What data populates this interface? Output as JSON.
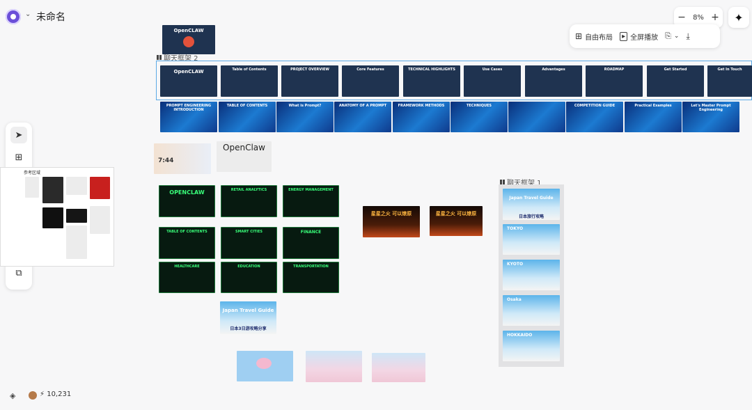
{
  "header": {
    "title": "未命名"
  },
  "zoom": {
    "minus": "−",
    "level": "8%",
    "plus": "+"
  },
  "toolbar": {
    "free_layout": "自由布局",
    "fullscreen": "全屏播放"
  },
  "frames": {
    "frame2": "聊天框架 2",
    "frame1": "聊天框架 1"
  },
  "ref_panel": {
    "label": "参考区域"
  },
  "credits": {
    "count": "10,231"
  },
  "slides": {
    "openclaw_top": "OpenCLAW",
    "row1": [
      "OpenCLAW",
      "Table of Contents",
      "PROJECT OVERVIEW",
      "Core Features",
      "TECHNICAL HIGHLIGHTS",
      "Use Cases",
      "Advantages",
      "ROADMAP",
      "Get Started",
      "Get In Touch"
    ],
    "row2": [
      "PROMPT ENGINEERING INTRODUCTION",
      "TABLE OF CONTENTS",
      "What is Prompt?",
      "ANATOMY OF A PROMPT",
      "FRAMEWORK METHODS",
      "TECHNIQUES",
      "",
      "COMPETITION GUIDE",
      "Practical Examples",
      "Let's Master Prompt Engineering"
    ],
    "clock": "7:44",
    "openclaw_plain": "OpenClaw",
    "green": [
      "OPENCLAW",
      "RETAIL ANALYTICS",
      "ENERGY MANAGEMENT",
      "TABLE OF CONTENTS",
      "SMART CITIES",
      "FINANCE",
      "HEALTHCARE",
      "EDUCATION",
      "TRANSPORTATION"
    ],
    "fire": [
      "星星之火 可以燎原",
      "星星之火 可以燎原"
    ],
    "japan_main": "Japan Travel Guide",
    "japan_main_sub": "日本3日游攻略分享",
    "frame1_slides": [
      "Japan Travel Guide",
      "TOKYO",
      "KYOTO",
      "Osaka",
      "HOKKAIDO"
    ],
    "frame1_sub": "日本旅行攻略"
  }
}
